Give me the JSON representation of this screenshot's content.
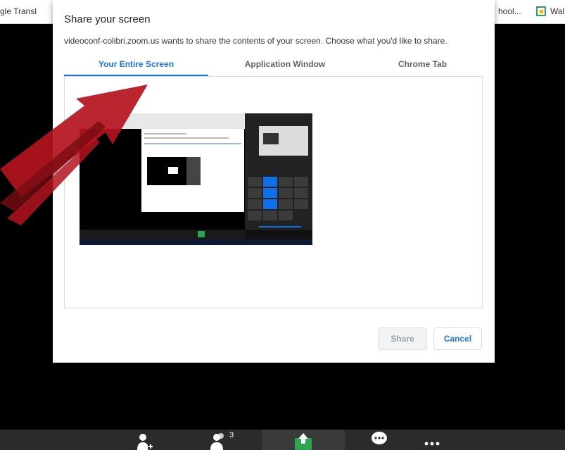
{
  "bookmarks": {
    "left_label": "gle Transl",
    "school_label": "hool...",
    "wal_label": "Wal"
  },
  "dialog": {
    "title": "Share your screen",
    "description": "videoconf-colibri.zoom.us wants to share the contents of your screen. Choose what you'd like to share.",
    "tabs": [
      {
        "label": "Your Entire Screen",
        "active": true
      },
      {
        "label": "Application Window",
        "active": false
      },
      {
        "label": "Chrome Tab",
        "active": false
      }
    ],
    "share_label": "Share",
    "cancel_label": "Cancel"
  },
  "toolbar": {
    "participants_count": "3"
  },
  "colors": {
    "accent": "#1a73e8",
    "arrow": "#b3141e",
    "share_green": "#2da44e"
  }
}
